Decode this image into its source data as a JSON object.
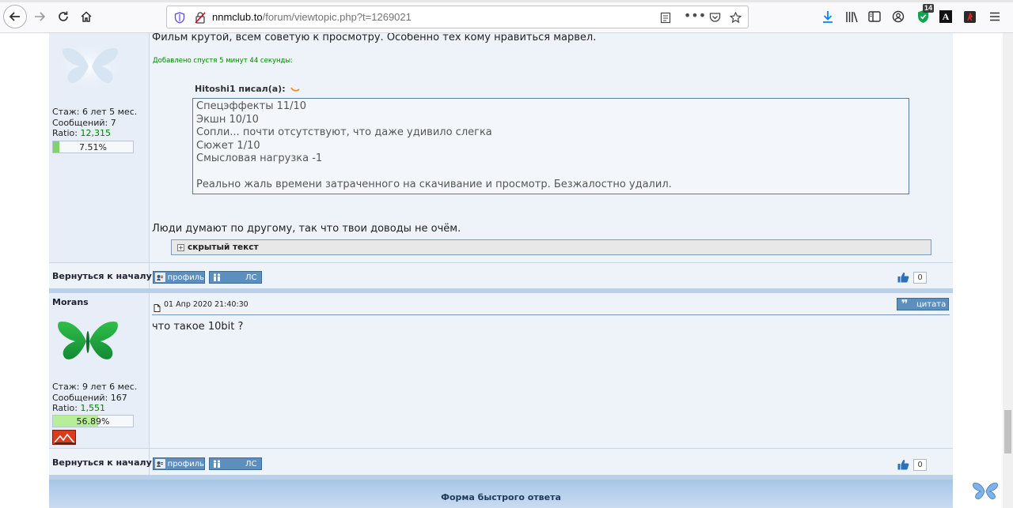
{
  "browser": {
    "url_host": "nnmclub.to",
    "url_path": "/forum/viewtopic.php?t=1269021",
    "extension_badge": "14"
  },
  "icons": {
    "back": "back-arrow-icon",
    "forward": "forward-arrow-icon",
    "reload": "reload-icon",
    "home": "home-icon",
    "shield": "tracking-shield-icon",
    "insecure_lock": "insecure-lock-icon",
    "reader": "reader-view-icon",
    "more": "page-actions-menu-icon",
    "pocket": "pocket-icon",
    "star": "bookmark-star-icon",
    "download": "download-icon",
    "library": "library-icon",
    "sidebar": "sidebar-icon",
    "account": "account-icon",
    "hamburger": "menu-icon"
  },
  "post1": {
    "user_stage": "Стаж: 6 лет 5 мес.",
    "user_messages": "Сообщений: 7",
    "ratio_label": "Ratio: ",
    "ratio_value": "12,315",
    "ratio_percent": "7.51%",
    "ratio_fraction": 0.0751,
    "text_top": "Фильм крутой, всем советую к просмотру. Особенно тех кому нравиться марвел.",
    "added_note": "Добавлено спустя 5 минут 44 секунды:",
    "quote_author": "Hitoshi1 писал(а):",
    "quote_lines": [
      "Спецэффекты 11/10",
      "Экшн 10/10",
      "Сопли... почти отсутствуют, что даже удивило слегка",
      "Сюжет 1/10",
      "Смысловая нагрузка -1",
      "",
      "Реально жаль времени затраченного на скачивание и просмотр. Безжалостно удалил."
    ],
    "text_bottom": "Люди думают по другому, так что твои доводы не очём.",
    "spoiler_label": "скрытый текст",
    "back_to_top": "Вернуться к началу",
    "profile_btn": "профиль",
    "pm_btn": "ЛС",
    "likes": "0"
  },
  "post2": {
    "username": "Morans",
    "date": "01 Апр 2020 21:40:30",
    "quote_btn": "цитата",
    "text": "что такое 10bit ?",
    "user_stage": "Стаж: 9 лет 6 мес.",
    "user_messages": "Сообщений: 167",
    "ratio_label": "Ratio: ",
    "ratio_value": "1,551",
    "ratio_percent": "56.89%",
    "ratio_fraction": 0.5689,
    "back_to_top": "Вернуться к началу",
    "profile_btn": "профиль",
    "pm_btn": "ЛС",
    "likes": "0"
  },
  "reply_form_title": "Форма быстрого ответа",
  "colors": {
    "forum_bg": "#eef3f9",
    "left_cell_bg": "#e7eef8",
    "accent_blue": "#5c8fbd",
    "ratio_green": "#008000",
    "butterfly_green": "#1e9c3a"
  }
}
